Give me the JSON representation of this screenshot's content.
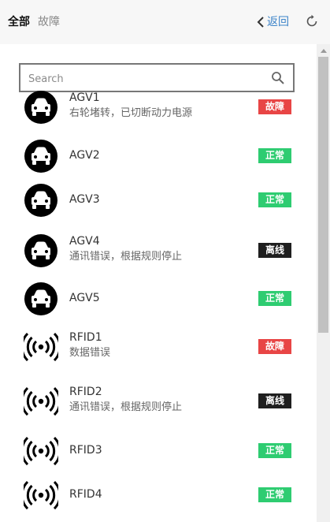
{
  "header": {
    "tab_all": "全部",
    "tab_fault": "故障",
    "back_label": "返回"
  },
  "search": {
    "placeholder": "Search"
  },
  "status_colors": {
    "故障": "#e84545",
    "正常": "#2ecc71",
    "离线": "#1f1f1f"
  },
  "items": [
    {
      "name": "AGV1",
      "desc": "右轮堵转，已切断动力电源",
      "status": "故障",
      "type": "agv",
      "icon": "car-icon"
    },
    {
      "name": "AGV2",
      "desc": "",
      "status": "正常",
      "type": "agv",
      "icon": "car-icon"
    },
    {
      "name": "AGV3",
      "desc": "",
      "status": "正常",
      "type": "agv",
      "icon": "car-icon"
    },
    {
      "name": "AGV4",
      "desc": "通讯错误，根据规则停止",
      "status": "离线",
      "type": "agv",
      "icon": "car-icon"
    },
    {
      "name": "AGV5",
      "desc": "",
      "status": "正常",
      "type": "agv",
      "icon": "car-icon"
    },
    {
      "name": "RFID1",
      "desc": "数据错误",
      "status": "故障",
      "type": "rfid",
      "icon": "rfid-signal-icon"
    },
    {
      "name": "RFID2",
      "desc": "通讯错误，根据规则停止",
      "status": "离线",
      "type": "rfid",
      "icon": "rfid-signal-icon"
    },
    {
      "name": "RFID3",
      "desc": "",
      "status": "正常",
      "type": "rfid",
      "icon": "rfid-signal-icon"
    },
    {
      "name": "RFID4",
      "desc": "",
      "status": "正常",
      "type": "rfid",
      "icon": "rfid-signal-icon"
    }
  ]
}
